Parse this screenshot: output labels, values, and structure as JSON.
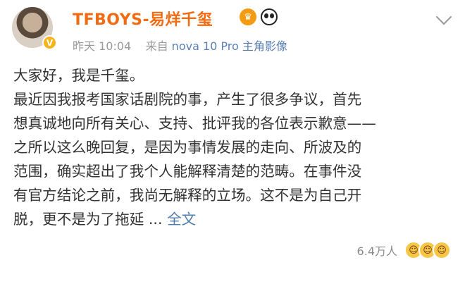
{
  "post": {
    "username": "TFBOYS-易烊千玺",
    "time": "昨天 10:04",
    "source_prefix": "来自",
    "source": "nova 10 Pro 主角影像",
    "paragraphs": [
      "大家好，我是千玺。",
      "最近因我报考国家话剧院的事，产生了很多争议，首先",
      "想真诚地向所有关心、支持、批评我的各位表示歉意——",
      "之所以这么晚回复，是因为事情发展的走向、所波及的",
      "范围，确实超出了我个人能解释清楚的范畴。在事件没",
      "有官方结论之前，我尚无解释的立场。这不是为自己开"
    ],
    "last_line": "脱，更不是为了拖延 ...",
    "full_text_link": "全文",
    "likes": "6.4万人"
  },
  "colors": {
    "username": "#f06b11",
    "link": "#507daf",
    "meta": "#999999"
  },
  "icons": [
    "crown-icon",
    "panda-icon",
    "chevron-down-icon",
    "verified-icon",
    "laugh-emoji-icon"
  ]
}
